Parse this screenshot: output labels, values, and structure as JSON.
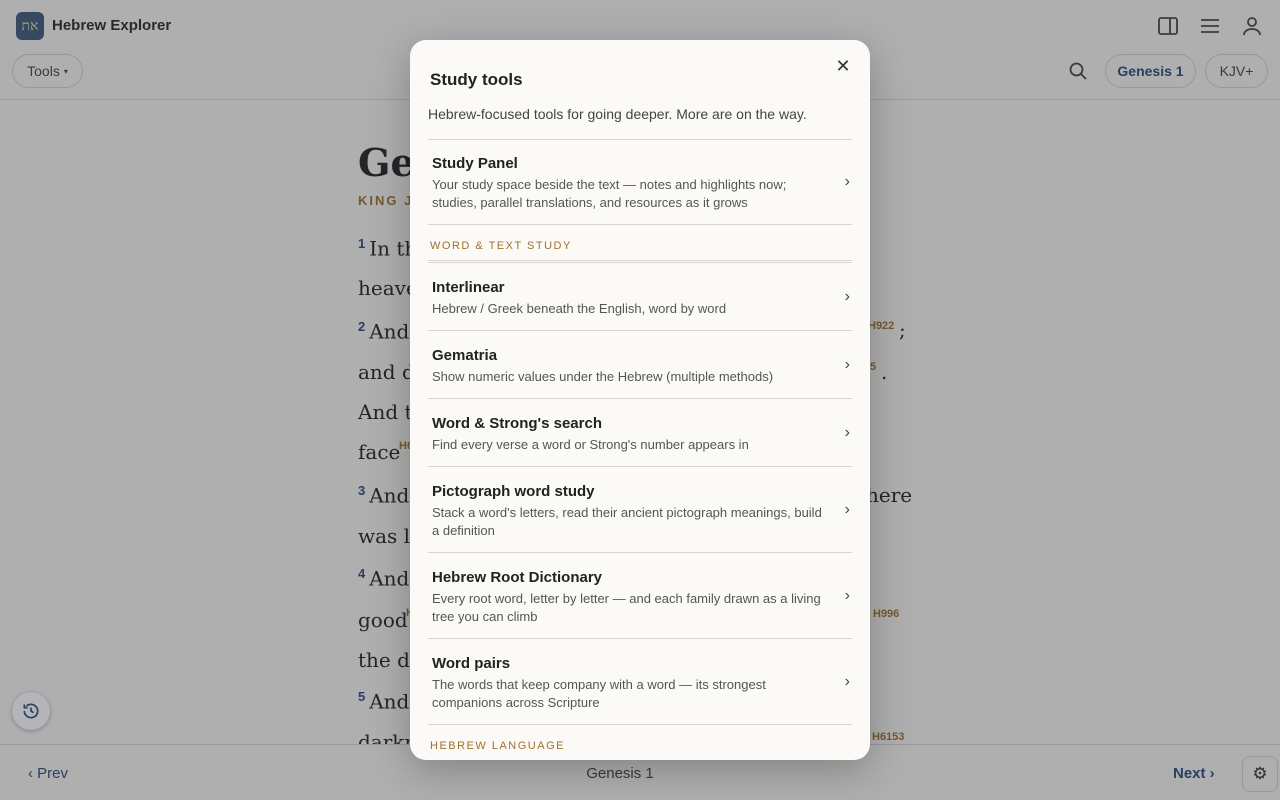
{
  "app": {
    "title": "Hebrew Explorer",
    "logo_glyph": "את"
  },
  "header": {
    "icons": [
      "sidebar-icon",
      "menu-icon",
      "user-icon"
    ]
  },
  "toolbar": {
    "tools_label": "Tools",
    "tools_caret": "▾",
    "chapter_pill": "Genesis 1",
    "version_pill": "KJV+"
  },
  "reader": {
    "title_fragment": "Gen",
    "version_fragment": "KING JA",
    "lines": [
      {
        "num": "1",
        "text": "In th"
      },
      {
        "num": "",
        "text": "heave"
      },
      {
        "num": "2",
        "text": "And"
      },
      {
        "num": "",
        "text": "and d"
      },
      {
        "num": "",
        "text": "And tl"
      },
      {
        "num": "",
        "text": "face"
      },
      {
        "num": "3",
        "text": "And"
      },
      {
        "num": "",
        "text": "was li"
      },
      {
        "num": "4",
        "text": "And"
      },
      {
        "num": "",
        "text": "good"
      },
      {
        "num": "",
        "text": "the da"
      },
      {
        "num": "5",
        "text": "And"
      },
      {
        "num": "",
        "text": "darkn"
      }
    ],
    "strongs_tags": {
      "face_tag": "H6",
      "good_tag": "H",
      "h922": "H922",
      "h_frag_line2": "5",
      "h996": "H996",
      "h6153": "H6153"
    },
    "right_fragments": {
      "semicolon": ";",
      "period": ".",
      "here": "here"
    }
  },
  "modal": {
    "title": "Study tools",
    "close_glyph": "✕",
    "description": "Hebrew-focused tools for going deeper. More are on the way.",
    "top_item": {
      "title": "Study Panel",
      "description": "Your study space beside the text — notes and highlights now; studies, parallel translations, and resources as it grows"
    },
    "sections": [
      {
        "header": "WORD & TEXT STUDY",
        "items": [
          {
            "title": "Interlinear",
            "description": "Hebrew / Greek beneath the English, word by word"
          },
          {
            "title": "Gematria",
            "description": "Show numeric values under the Hebrew (multiple methods)"
          },
          {
            "title": "Word & Strong's search",
            "description": "Find every verse a word or Strong's number appears in"
          },
          {
            "title": "Pictograph word study",
            "description": "Stack a word's letters, read their ancient pictograph meanings, build a definition"
          },
          {
            "title": "Hebrew Root Dictionary",
            "description": "Every root word, letter by letter — and each family drawn as a living tree you can climb"
          },
          {
            "title": "Word pairs",
            "description": "The words that keep company with a word — its strongest companions across Scripture"
          }
        ]
      },
      {
        "header": "HEBREW LANGUAGE",
        "items": []
      }
    ],
    "chevron_glyph": "›"
  },
  "footer": {
    "prev_label": "‹ Prev",
    "chapter_label": "Genesis 1",
    "next_label": "Next ›",
    "settings_glyph": "⚙"
  },
  "colors": {
    "accent_blue": "#2a4a7d",
    "accent_gold": "#a0702c",
    "background": "#f7f6f3"
  }
}
